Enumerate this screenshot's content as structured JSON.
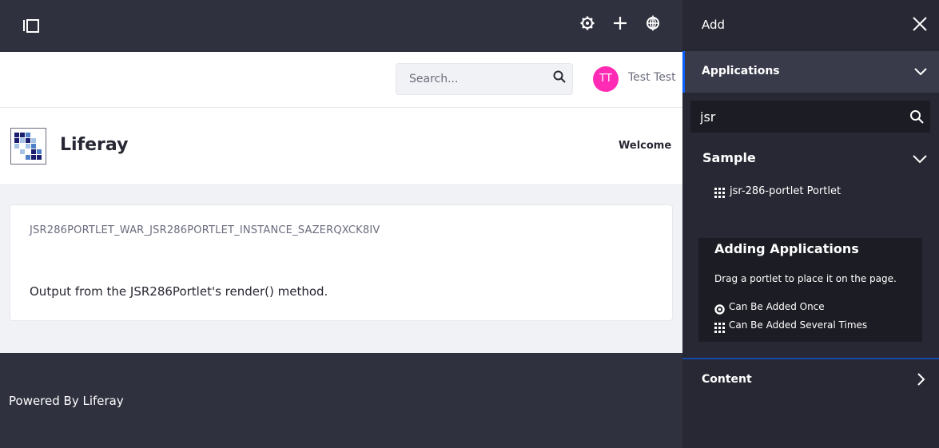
{
  "control_menu": {
    "icons": [
      "sidebar-toggle-icon",
      "gear-icon",
      "plus-icon",
      "simulation-icon"
    ]
  },
  "header": {
    "search_placeholder": "Search...",
    "avatar_initials": "TT",
    "user_name": "Test Test"
  },
  "site": {
    "name": "Liferay",
    "nav_items": [
      "Welcome"
    ]
  },
  "portlet": {
    "title": "JSR286PORTLET_WAR_JSR286PORTLET_INSTANCE_SAZERQXCK8IV",
    "body": "Output from the JSR286Portlet's render() method."
  },
  "footer": {
    "text": "Powered By Liferay"
  },
  "add_panel": {
    "title": "Add",
    "applications_label": "Applications",
    "search_value": "jsr",
    "category_label": "Sample",
    "app_items": [
      "jsr-286-portlet Portlet"
    ],
    "help": {
      "title": "Adding Applications",
      "text": "Drag a portlet to place it on the page.",
      "once_label": "Can Be Added Once",
      "several_label": "Can Be Added Several Times"
    },
    "content_label": "Content"
  },
  "colors": {
    "control_bar": "#30313f",
    "panel_bg": "#272833",
    "accent": "#0b5fff",
    "avatar": "#ff2bb4"
  }
}
